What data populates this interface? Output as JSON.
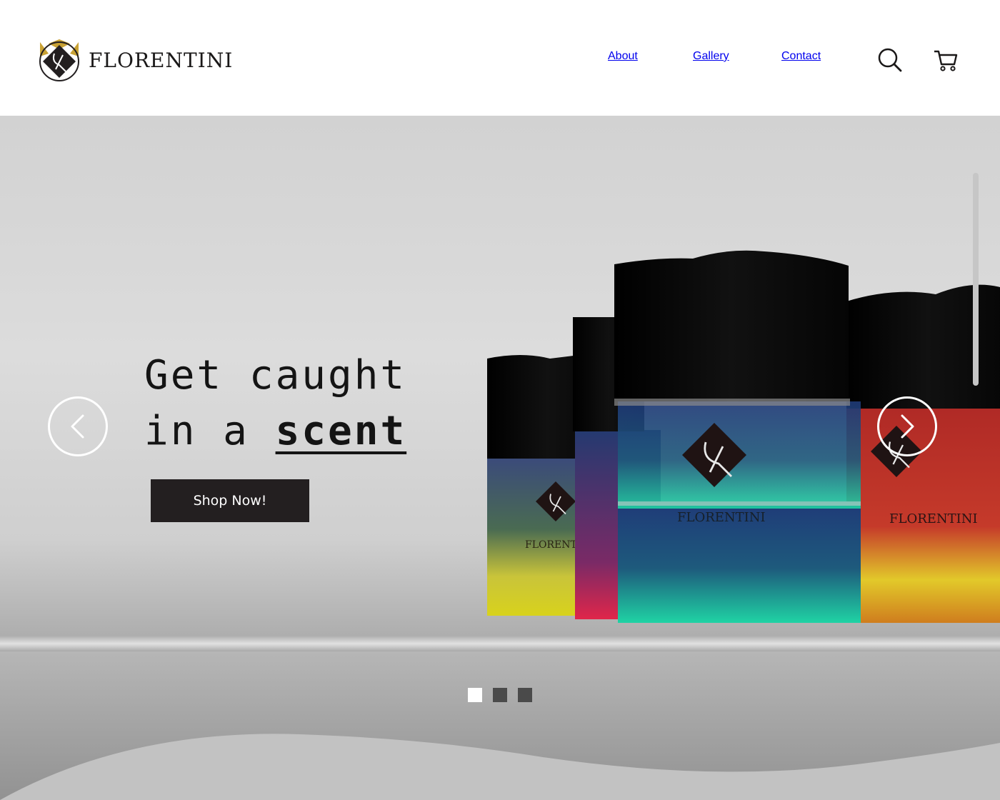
{
  "brand": {
    "name": "FLORENTINI",
    "accent_gold": "#c9a234",
    "dark": "#231f20"
  },
  "nav": {
    "items": [
      {
        "label": "About"
      },
      {
        "label": "Gallery"
      },
      {
        "label": "Contact"
      }
    ],
    "search_icon": "search-icon",
    "cart_icon": "cart-icon"
  },
  "hero": {
    "headline_line1": "Get caught",
    "headline_line2_prefix": "in a ",
    "headline_line2_bold": "scent",
    "cta_label": "Shop Now!",
    "prev_icon": "chevron-left-icon",
    "next_icon": "chevron-right-icon",
    "slides": {
      "count": 3,
      "active_index": 0
    },
    "product_labels": [
      "FLORENTINI",
      "FLORENTINI",
      "FLORENTINI"
    ]
  }
}
